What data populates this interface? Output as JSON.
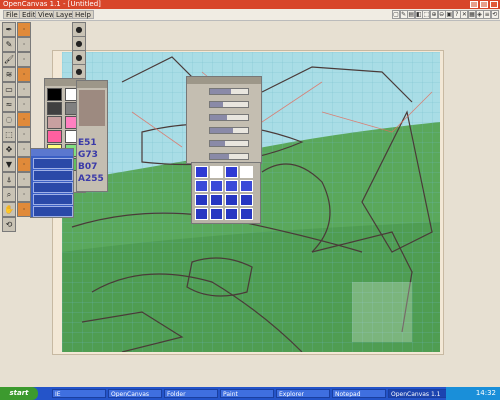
{
  "window": {
    "title": "OpenCanvas 1.1 - [Untitled]"
  },
  "menu": {
    "items": [
      "File",
      "Edit",
      "View",
      "Layer",
      "Help"
    ]
  },
  "right_toolbar": {
    "buttons": [
      "▢",
      "✎",
      "▤",
      "◧",
      "⬚",
      "⊕",
      "⊖",
      "▣",
      "?",
      "✕",
      "▦",
      "◈",
      "≡",
      "⟲"
    ]
  },
  "tools": {
    "icons": [
      "pen-icon",
      "pencil-icon",
      "brush-icon",
      "airbrush-icon",
      "eraser-icon",
      "watercolor-icon",
      "blur-icon",
      "select-icon",
      "move-icon",
      "fill-icon",
      "eyedropper-icon",
      "zoom-icon",
      "hand-icon",
      "rotate-icon"
    ]
  },
  "colors": {
    "accent": "#d8462a",
    "palette": [
      "#000000",
      "#ffffff",
      "#404040",
      "#808080",
      "#c8a0a0",
      "#ff80c0",
      "#ff60a0",
      "#ffffff",
      "#ffff80",
      "#80e080",
      "#ff8040",
      "#60c060"
    ],
    "current": "#9d8a80"
  },
  "color_values": [
    "E51",
    "G73",
    "B07",
    "A255"
  ],
  "sliders": {
    "rows": [
      {
        "label": "",
        "value": 55
      },
      {
        "label": "",
        "value": 35
      },
      {
        "label": "",
        "value": 45
      },
      {
        "label": "",
        "value": 60
      },
      {
        "label": "",
        "value": 40
      },
      {
        "label": "",
        "value": 50
      }
    ]
  },
  "layers": {
    "items": [
      "",
      "",
      "",
      "",
      ""
    ]
  },
  "taskbar": {
    "start_label": "start",
    "tasks": [
      "IE",
      "OpenCanvas",
      "Folder",
      "Paint",
      "Explorer",
      "Notepad",
      "OpenCanvas 1.1"
    ],
    "clock": "14:32"
  }
}
